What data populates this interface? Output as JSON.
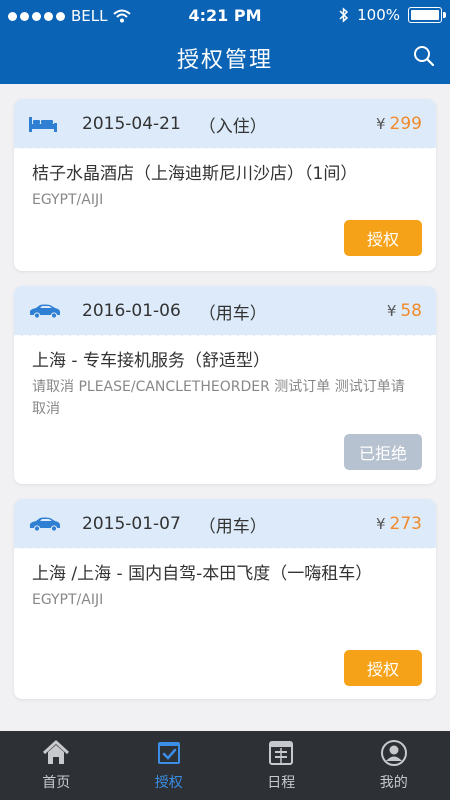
{
  "status_bar": {
    "carrier": "BELL",
    "time": "4:21 PM",
    "battery": "100%"
  },
  "header": {
    "title": "授权管理"
  },
  "orders": [
    {
      "icon": "bed-icon",
      "date": "2015-04-21",
      "kind": "（入住）",
      "currency": "¥",
      "price": "299",
      "name": "桔子水晶酒店（上海迪斯尼川沙店）（1间）",
      "sub": "EGYPT/AIJI",
      "action": "授权",
      "action_state": "active"
    },
    {
      "icon": "car-icon",
      "date": "2016-01-06",
      "kind": "（用车）",
      "currency": "¥",
      "price": "58",
      "name": "上海 - 专车接机服务（舒适型）",
      "sub": "请取消 PLEASE/CANCLETHEORDER 测试订单 测试订单请取消",
      "action": "已拒绝",
      "action_state": "disabled"
    },
    {
      "icon": "car-icon",
      "date": "2015-01-07",
      "kind": "（用车）",
      "currency": "¥",
      "price": "273",
      "name": "上海 /上海 - 国内自驾-本田飞度（一嗨租车）",
      "sub": "EGYPT/AIJI",
      "action": "授权",
      "action_state": "active"
    }
  ],
  "tabbar": {
    "items": [
      {
        "label": "首页",
        "icon": "home-icon",
        "active": false
      },
      {
        "label": "授权",
        "icon": "authorize-icon",
        "active": true
      },
      {
        "label": "日程",
        "icon": "calendar-icon",
        "active": false
      },
      {
        "label": "我的",
        "icon": "profile-icon",
        "active": false
      }
    ]
  },
  "colors": {
    "brand": "#0a63b4",
    "accent": "#f6a219",
    "price": "#f18a2a",
    "tab_active": "#3a8ee6"
  }
}
